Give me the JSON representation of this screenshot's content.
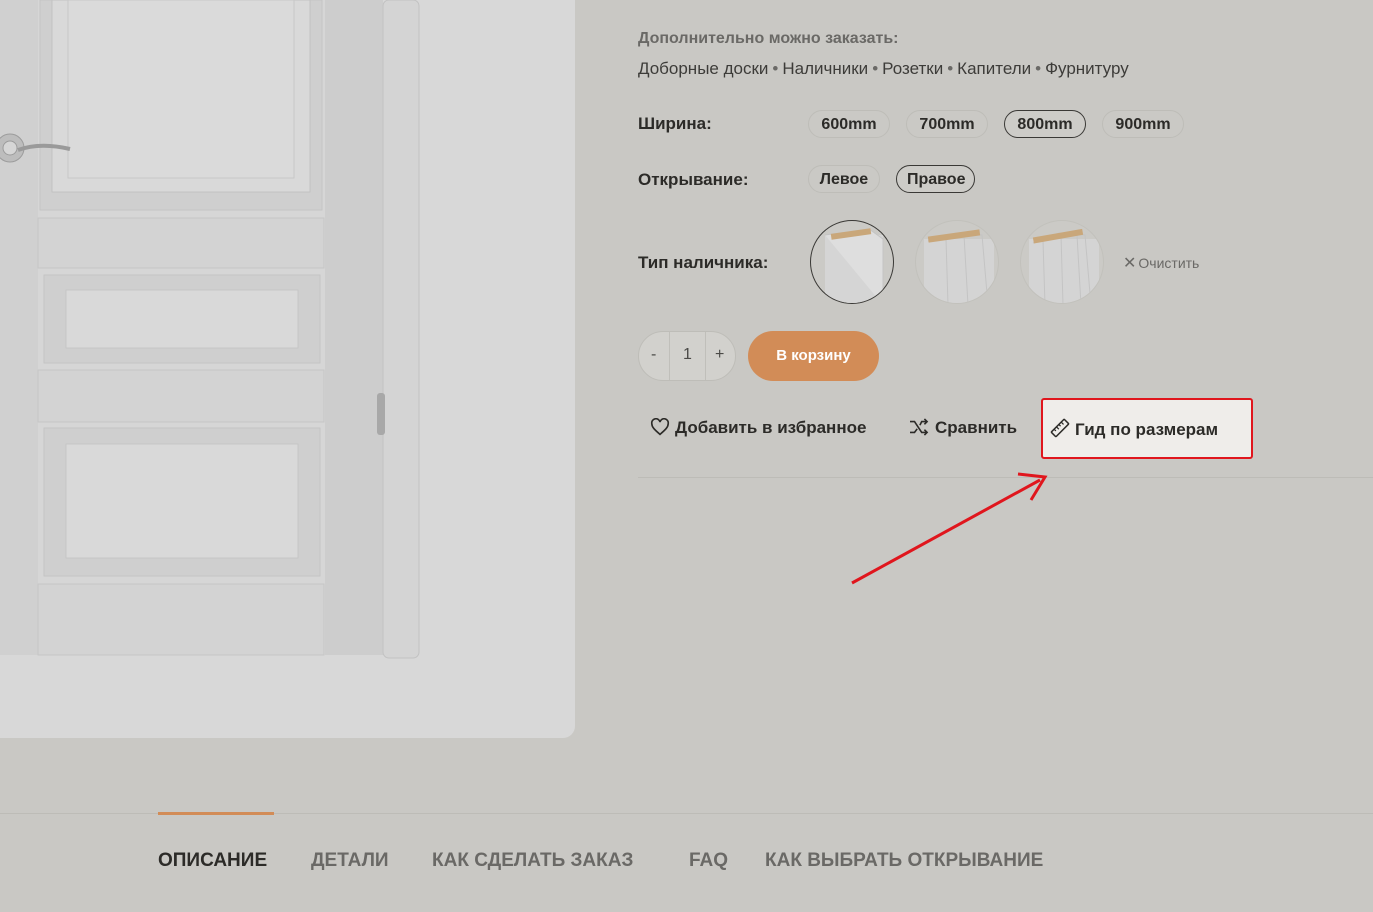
{
  "extras": {
    "title": "Дополнительно можно заказать:",
    "items": [
      "Доборные доски",
      "Наличники",
      "Розетки",
      "Капители",
      "Фурнитуру"
    ],
    "separator": "•"
  },
  "width_option": {
    "label": "Ширина:",
    "options": [
      "600mm",
      "700mm",
      "800mm",
      "900mm"
    ],
    "selected": "800mm"
  },
  "opening_option": {
    "label": "Открывание:",
    "options": [
      "Левое",
      "Правое"
    ],
    "selected": "Правое"
  },
  "casing_option": {
    "label": "Тип наличника:",
    "clear_label": "Очистить",
    "selected_index": 0
  },
  "cart": {
    "minus": "-",
    "quantity": "1",
    "plus": "+",
    "button_label": "В корзину",
    "button_color": "#d28c57"
  },
  "actions": {
    "wishlist": "Добавить в избранное",
    "compare": "Сравнить",
    "size_guide": "Гид по размерам"
  },
  "annotation": {
    "color": "#e0161d"
  },
  "tabs": [
    {
      "label": "ОПИСАНИЕ",
      "active": true
    },
    {
      "label": "ДЕТАЛИ",
      "active": false
    },
    {
      "label": "КАК СДЕЛАТЬ ЗАКАЗ",
      "active": false
    },
    {
      "label": "FAQ",
      "active": false
    },
    {
      "label": "КАК ВЫБРАТЬ ОТКРЫВАНИЕ",
      "active": false
    }
  ]
}
